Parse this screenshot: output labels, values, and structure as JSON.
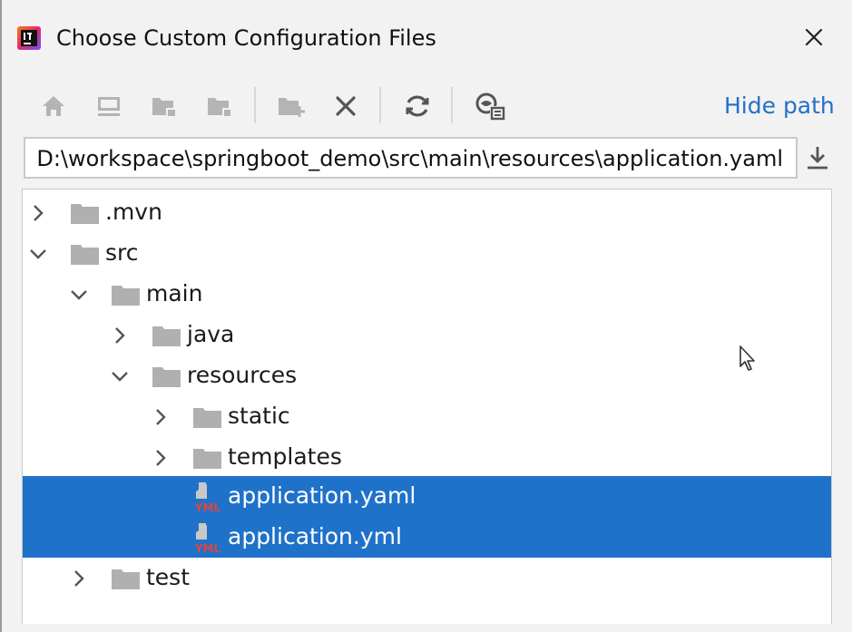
{
  "dialog": {
    "title": "Choose Custom Configuration Files",
    "app_icon": "intellij-idea-logo-icon",
    "close_icon": "close-icon"
  },
  "toolbar": {
    "buttons": [
      {
        "name": "home-button",
        "icon": "home-icon",
        "enabled": false
      },
      {
        "name": "desktop-button",
        "icon": "desktop-icon",
        "enabled": false
      },
      {
        "name": "project-folder-button",
        "icon": "project-folder-icon",
        "enabled": false
      },
      {
        "name": "module-folder-button",
        "icon": "module-folder-icon",
        "enabled": false
      },
      {
        "name": "new-folder-button",
        "icon": "new-folder-icon",
        "enabled": false
      },
      {
        "name": "delete-button",
        "icon": "delete-x-icon",
        "enabled": true
      },
      {
        "name": "refresh-button",
        "icon": "refresh-icon",
        "enabled": true
      },
      {
        "name": "show-hidden-button",
        "icon": "show-hidden-files-icon",
        "enabled": true
      }
    ],
    "hide_path_label": "Hide path"
  },
  "path_field": {
    "value": "D:\\workspace\\springboot_demo\\src\\main\\resources\\application.yaml",
    "download_icon": "download-icon"
  },
  "tree": {
    "items": [
      {
        "label": ".mvn",
        "type": "folder",
        "expanded": false,
        "selected": false
      },
      {
        "label": "src",
        "type": "folder",
        "expanded": true,
        "selected": false
      },
      {
        "label": "main",
        "type": "folder",
        "expanded": true,
        "selected": false
      },
      {
        "label": "java",
        "type": "folder",
        "expanded": false,
        "selected": false
      },
      {
        "label": "resources",
        "type": "folder",
        "expanded": true,
        "selected": false
      },
      {
        "label": "static",
        "type": "folder",
        "expanded": false,
        "selected": false
      },
      {
        "label": "templates",
        "type": "folder",
        "expanded": false,
        "selected": false
      },
      {
        "label": "application.yaml",
        "type": "yaml-file",
        "selected": true
      },
      {
        "label": "application.yml",
        "type": "yaml-file",
        "selected": true
      },
      {
        "label": "test",
        "type": "folder",
        "expanded": false,
        "selected": false
      }
    ],
    "file_icon_text": "YML"
  },
  "colors": {
    "background": "#f2f2f2",
    "selection": "#1f72c9",
    "link": "#2470c6",
    "folder": "#b0b0b0",
    "disabled_icon": "#b4b4b4",
    "enabled_icon": "#555555",
    "yml_label": "#e0453a"
  }
}
